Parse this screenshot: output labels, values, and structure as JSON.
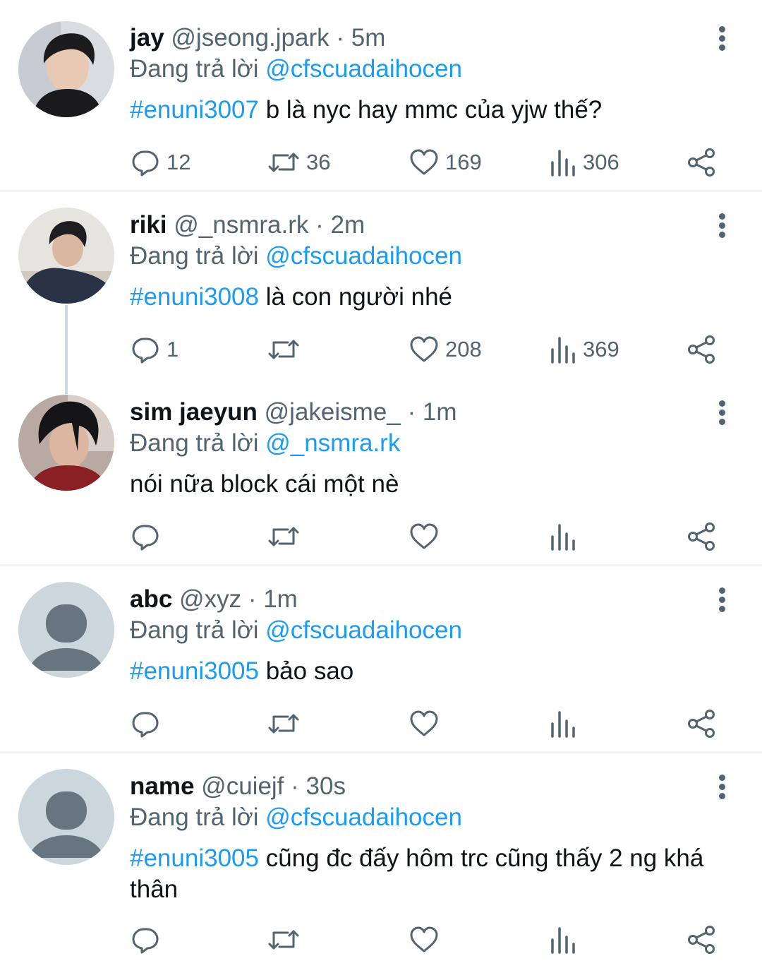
{
  "replies": [
    {
      "name": "jay",
      "handle": "@jseong.jpark",
      "time": "5m",
      "reply_prefix": "Đang trả lời",
      "reply_to": "@cfscuadaihocen",
      "hashtag": "#enuni3007",
      "text": " b là nyc hay mmc của yjw thế?",
      "counts": {
        "replies": "12",
        "retweets": "36",
        "likes": "169",
        "views": "306"
      }
    },
    {
      "name": "riki",
      "handle": "@_nsmra.rk",
      "time": "2m",
      "reply_prefix": "Đang trả lời",
      "reply_to": "@cfscuadaihocen",
      "hashtag": "#enuni3008",
      "text": " là con người nhé",
      "counts": {
        "replies": "1",
        "retweets": "",
        "likes": "208",
        "views": "369"
      }
    },
    {
      "name": "sim jaeyun",
      "handle": "@jakeisme_",
      "time": "1m",
      "reply_prefix": "Đang trả lời",
      "reply_to": "@_nsmra.rk",
      "hashtag": "",
      "text": "nói nữa block cái một nè",
      "counts": {
        "replies": "",
        "retweets": "",
        "likes": "",
        "views": ""
      }
    },
    {
      "name": "abc",
      "handle": "@xyz",
      "time": "1m",
      "reply_prefix": "Đang trả lời",
      "reply_to": "@cfscuadaihocen",
      "hashtag": "#enuni3005",
      "text": " bảo sao",
      "counts": {
        "replies": "",
        "retweets": "",
        "likes": "",
        "views": ""
      }
    },
    {
      "name": "name",
      "handle": "@cuiejf",
      "time": "30s",
      "reply_prefix": "Đang trả lời",
      "reply_to": "@cfscuadaihocen",
      "hashtag": "#enuni3005",
      "text": " cũng đc đấy hôm trc cũng thấy 2 ng khá thân",
      "counts": {
        "replies": "",
        "retweets": "",
        "likes": "",
        "views": ""
      }
    }
  ],
  "separator": "·",
  "colors": {
    "accent": "#1d9bf0",
    "secondary_text": "#536471",
    "divider": "#eff3f4",
    "thread_line": "#cfd9de"
  },
  "icons": [
    "reply-icon",
    "retweet-icon",
    "like-icon",
    "views-icon",
    "share-icon",
    "more-options-icon"
  ]
}
